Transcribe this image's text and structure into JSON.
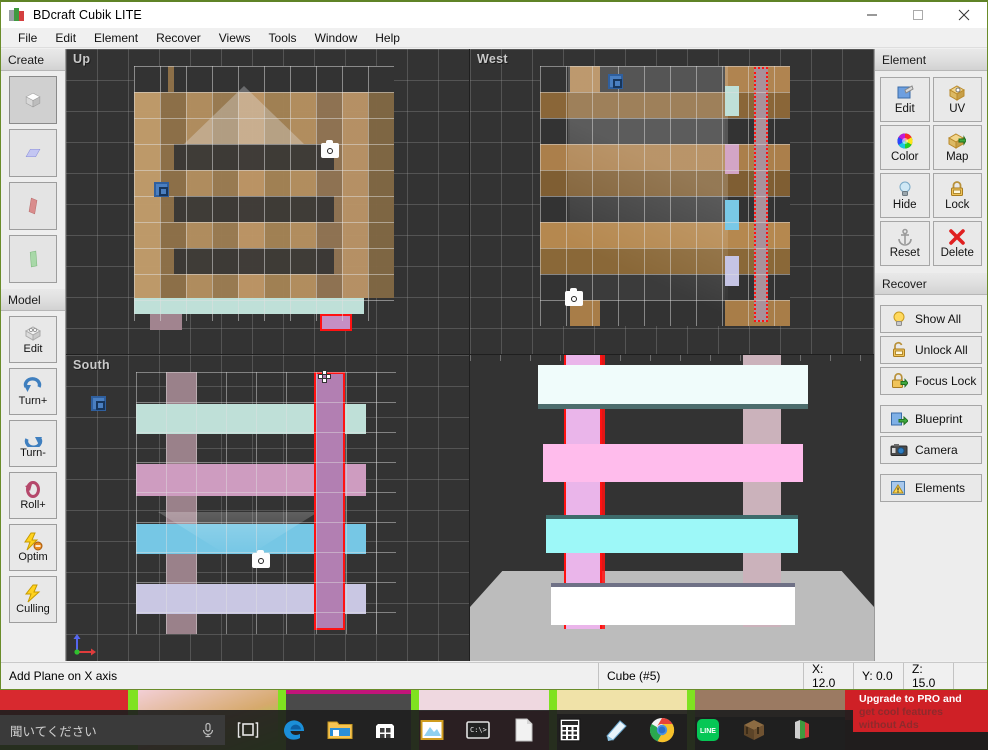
{
  "window": {
    "title": "BDcraft Cubik LITE",
    "icon": "cubik-logo-icon",
    "buttons": {
      "minimize": "—",
      "maximize": "□",
      "close": "✕"
    }
  },
  "menubar": {
    "items": [
      "File",
      "Edit",
      "Element",
      "Recover",
      "Views",
      "Tools",
      "Window",
      "Help"
    ]
  },
  "left_toolbar": {
    "create": {
      "title": "Create",
      "tools": [
        {
          "name": "cube-tool",
          "icon": "cube-icon",
          "selected": true
        },
        {
          "name": "plane-y-tool",
          "icon": "plane-blue-icon",
          "selected": false
        },
        {
          "name": "plane-x-tool",
          "icon": "plane-red-icon",
          "selected": false
        },
        {
          "name": "plane-z-tool",
          "icon": "plane-green-icon",
          "selected": false
        }
      ]
    },
    "model": {
      "title": "Model",
      "tools": [
        {
          "label": "Edit",
          "icon": "model-edit-icon"
        },
        {
          "label": "Turn+",
          "icon": "turn-plus-icon"
        },
        {
          "label": "Turn-",
          "icon": "turn-minus-icon"
        },
        {
          "label": "Roll+",
          "icon": "roll-plus-icon"
        },
        {
          "label": "Optim",
          "icon": "optimize-icon"
        },
        {
          "label": "Culling",
          "icon": "culling-icon"
        }
      ]
    }
  },
  "right_panel": {
    "element": {
      "title": "Element",
      "buttons": [
        {
          "label": "Edit",
          "icon": "element-edit-icon"
        },
        {
          "label": "UV",
          "icon": "uv-icon"
        },
        {
          "label": "Color",
          "icon": "color-wheel-icon"
        },
        {
          "label": "Map",
          "icon": "map-icon"
        },
        {
          "label": "Hide",
          "icon": "bulb-icon"
        },
        {
          "label": "Lock",
          "icon": "lock-icon"
        },
        {
          "label": "Reset",
          "icon": "anchor-icon"
        },
        {
          "label": "Delete",
          "icon": "delete-x-icon"
        }
      ]
    },
    "recover": {
      "title": "Recover",
      "buttons": [
        {
          "label": "Show All",
          "icon": "bulb-icon"
        },
        {
          "label": "Unlock All",
          "icon": "unlock-icon"
        },
        {
          "label": "Focus Lock",
          "icon": "focus-lock-icon"
        },
        {
          "label": "Blueprint",
          "icon": "blueprint-icon"
        },
        {
          "label": "Camera",
          "icon": "camera-icon"
        },
        {
          "label": "Elements",
          "icon": "elements-icon"
        }
      ]
    }
  },
  "viewports": [
    {
      "name": "viewport-up",
      "label": "Up"
    },
    {
      "name": "viewport-west",
      "label": "West"
    },
    {
      "name": "viewport-south",
      "label": "South"
    },
    {
      "name": "viewport-perspective",
      "label": ""
    }
  ],
  "statusbar": {
    "message": "Add Plane on X axis",
    "element": "Cube (#5)",
    "x": "X: 12.0",
    "y": "Y: 0.0",
    "z": "Z: 15.0"
  },
  "taskbar": {
    "search_placeholder": "聞いてください",
    "mic_icon": "microphone-icon",
    "taskview_icon": "task-view-icon",
    "apps": [
      {
        "name": "edge-icon",
        "label": "Microsoft Edge"
      },
      {
        "name": "file-explorer-icon",
        "label": "File Explorer"
      },
      {
        "name": "store-icon",
        "label": "Microsoft Store"
      },
      {
        "name": "photos-icon",
        "label": "Photos"
      },
      {
        "name": "cmd-icon",
        "label": "Command Prompt"
      },
      {
        "name": "notepad-icon",
        "label": "Notepad"
      },
      {
        "name": "calculator-icon",
        "label": "Calculator"
      },
      {
        "name": "paint-icon",
        "label": "Paint"
      },
      {
        "name": "chrome-icon",
        "label": "Google Chrome"
      },
      {
        "name": "line-icon",
        "label": "LINE"
      },
      {
        "name": "minecraft-icon",
        "label": "Minecraft"
      },
      {
        "name": "cubik-icon",
        "label": "BDcraft Cubik LITE"
      }
    ]
  },
  "ad": {
    "line1": "Upgrade to PRO and",
    "line2": "get cool features",
    "line3": "without Ads"
  },
  "colors": {
    "accent_green": "#6a8c2a",
    "viewport_bg": "#333333",
    "selection_red": "#ff1f1f",
    "handle_blue": "#4a7fc1",
    "status_bg": "#f0f0f0"
  }
}
